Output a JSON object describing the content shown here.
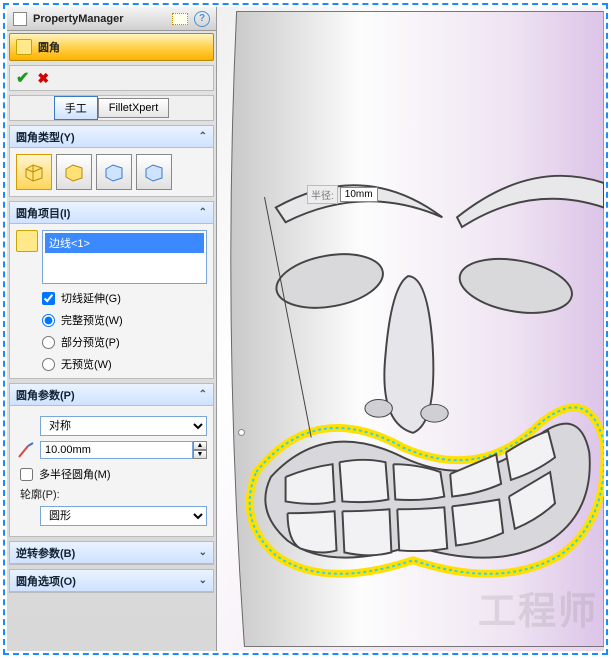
{
  "header": {
    "title": "PropertyManager"
  },
  "feature": {
    "name": "圆角"
  },
  "tabs": {
    "manual": "手工",
    "xpert": "FilletXpert"
  },
  "sections": {
    "type": {
      "title": "圆角类型(Y)"
    },
    "items": {
      "title": "圆角项目(I)",
      "selection": [
        "边线<1>"
      ],
      "tangent": "切线延伸(G)",
      "fullPreview": "完整预览(W)",
      "partialPreview": "部分预览(P)",
      "noPreview": "无预览(W)"
    },
    "params": {
      "title": "圆角参数(P)",
      "symmetry": "对称",
      "radiusValue": "10.00mm",
      "multiRadius": "多半径圆角(M)",
      "profileLabel": "轮廓(P):",
      "profile": "圆形"
    },
    "reverse": {
      "title": "逆转参数(B)"
    },
    "options": {
      "title": "圆角选项(O)"
    }
  },
  "callout": {
    "label": "半径:",
    "value": "10mm"
  },
  "watermark": "工程师"
}
